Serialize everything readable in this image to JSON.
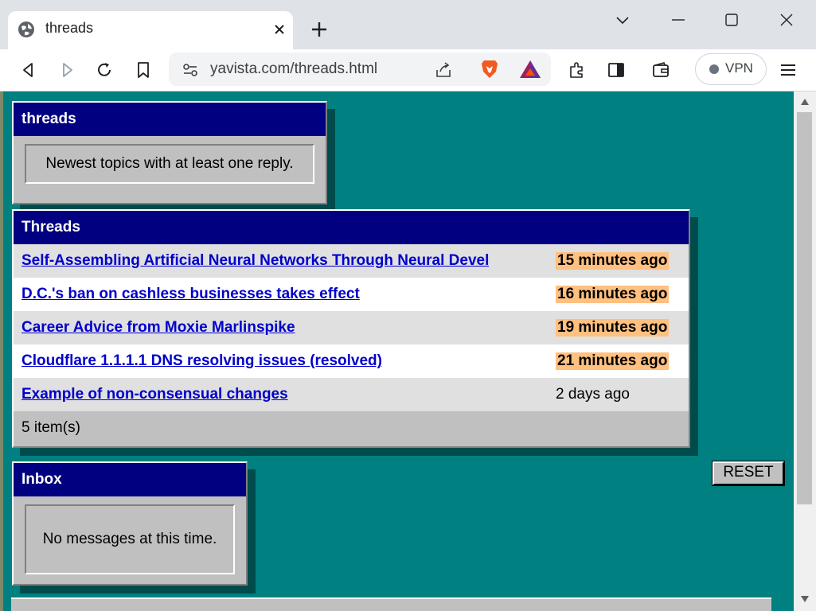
{
  "browser": {
    "tab_title": "threads",
    "url": "yavista.com/threads.html",
    "vpn_label": "VPN"
  },
  "page": {
    "header_window": {
      "title": "threads",
      "description": "Newest topics with at least one reply."
    },
    "threads_window": {
      "title": "Threads",
      "rows": [
        {
          "title": "Self-Assembling Artificial Neural Networks Through Neural Devel",
          "time": "15 minutes ago",
          "highlight": true
        },
        {
          "title": "D.C.'s ban on cashless businesses takes effect",
          "time": "16 minutes ago",
          "highlight": true
        },
        {
          "title": "Career Advice from Moxie Marlinspike",
          "time": "19 minutes ago",
          "highlight": true
        },
        {
          "title": "Cloudflare 1.1.1.1 DNS resolving issues (resolved)",
          "time": "21 minutes ago",
          "highlight": true
        },
        {
          "title": "Example of non-consensual changes",
          "time": "2 days ago",
          "highlight": false
        }
      ],
      "count": "5 item(s)"
    },
    "reset_label": "RESET",
    "inbox_window": {
      "title": "Inbox",
      "message": "No messages at this time."
    }
  },
  "colors": {
    "desktop": "#008080",
    "titlebar": "#000080",
    "highlight": "#ffc080",
    "link": "#0000cc"
  }
}
